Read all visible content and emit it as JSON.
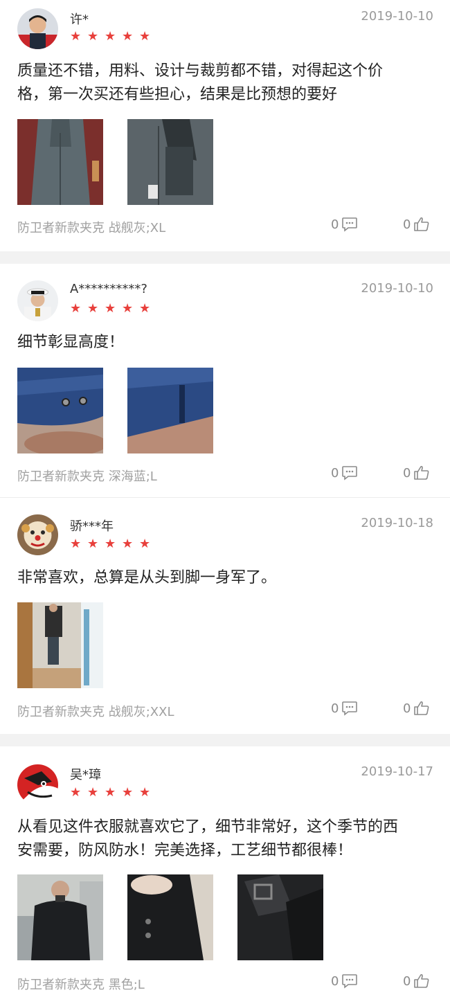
{
  "reviews": [
    {
      "username": "许*",
      "date": "2019-10-10",
      "rating": 5,
      "content_line1": "质量还不错，用料、设计与裁剪都不错，对得起这个价",
      "content_line2": "格，第一次买还有些担心，结果是比预想的要好",
      "photos": [
        "gray-jacket-hanging",
        "gray-jacket-detail"
      ],
      "spec": "防卫者新款夹克 战舰灰;XL",
      "comments": "0",
      "likes": "0"
    },
    {
      "username": "A**********?",
      "date": "2019-10-10",
      "rating": 5,
      "content_line1": "细节彰显高度！",
      "content_line2": "",
      "photos": [
        "navy-cuff-detail",
        "navy-zipper-detail"
      ],
      "spec": "防卫者新款夹克 深海蓝;L",
      "comments": "0",
      "likes": "0"
    },
    {
      "username": "骄***年",
      "date": "2019-10-18",
      "rating": 5,
      "content_line1": "非常喜欢，总算是从头到脚一身军了。",
      "content_line2": "",
      "photos": [
        "mirror-selfie"
      ],
      "spec": "防卫者新款夹克 战舰灰;XXL",
      "comments": "0",
      "likes": "0"
    },
    {
      "username": "吴*璋",
      "date": "2019-10-17",
      "rating": 5,
      "content_line1": "从看见这件衣服就喜欢它了，细节非常好，这个季节的西",
      "content_line2": "安需要，防风防水！完美选择，工艺细节都很棒！",
      "photos": [
        "black-jacket-worn",
        "black-cuff-detail",
        "black-collar-detail"
      ],
      "spec": "防卫者新款夹克 黑色;L",
      "comments": "0",
      "likes": "0"
    }
  ],
  "colors": {
    "star": "#e8403c",
    "muted": "#9a9a9a",
    "separator": "#f2f2f2"
  },
  "icons": {
    "comment": "comment-bubble-icon",
    "like": "thumbs-up-icon",
    "star": "star-icon"
  }
}
